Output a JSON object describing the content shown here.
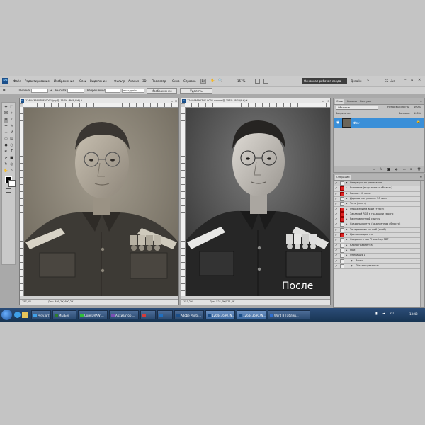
{
  "menu": {
    "items": [
      "Файл",
      "Редактирование",
      "Изображение",
      "Слои",
      "Выделение",
      "Фильтр",
      "Анализ",
      "3D",
      "Просмотр",
      "Окно",
      "Справка"
    ],
    "zoom": "157%",
    "workspace": "Основная рабочая среда",
    "design": "Дизайн",
    "cslive": "CS Live"
  },
  "options": {
    "width_label": "Ширина:",
    "height_label": "Высота:",
    "resolution_label": "Разрешение:",
    "resolution_unit": "пикс/дюйм",
    "image_button": "Изображение",
    "clear_button": "Удалить"
  },
  "documents": [
    {
      "title": "1264436907NF-0001.jpg @ 157% (RGB/8#) *",
      "status_zoom": "157,2%",
      "status_doc": "Док: 490,2К/490,2К"
    },
    {
      "title": "1264436907NF-0001 копия @ 157% (RGB/8#) *",
      "status_zoom": "157,2%",
      "status_doc": "Док: 521,0К/521,0К",
      "overlay": "После"
    }
  ],
  "layers_panel": {
    "tabs": [
      "Слои",
      "Каналы",
      "Контуры"
    ],
    "blend_mode": "Обычные",
    "opacity_label": "Непрозрачность:",
    "opacity_value": "100%",
    "lock_label": "Закрепить:",
    "fill_label": "Заливка:",
    "fill_value": "100%",
    "layer_name": "Фон"
  },
  "actions_panel": {
    "tab": "Операции",
    "items": [
      "Операции по умолчанию",
      "Виньетка (выделенная область)",
      "Рамка - 50 пикс.",
      "Деревянная рамка - 50 пикс.",
      "Тень (текст)",
      "Отражение в воде (текст)",
      "Заказной RGB в градации серого",
      "Расплавленный свинец",
      "Создать контур (выделенная область)",
      "Тонирование сепией (слой)",
      "Цвета квадранта",
      "Сохранить как Photoshop PDF",
      "Карта градиента",
      "Мой",
      "Операция 1",
      "Рамка",
      "Лёгкая цветность"
    ]
  },
  "taskbar": {
    "items": [
      "Результат по...",
      "Мы Бег",
      "CorelDRAW ...",
      "Архиватор ...",
      "",
      "",
      "Adobe Photo...",
      "1264436907N...",
      "1264436907N...",
      "Word В Таблиц..."
    ],
    "clock": "13:48"
  },
  "colors": {
    "window_bg": "#a9a9a9",
    "layer_selected": "#3a8fd8",
    "taskbar": "#1f3c61",
    "workspace_button": "#3d3d3d"
  }
}
